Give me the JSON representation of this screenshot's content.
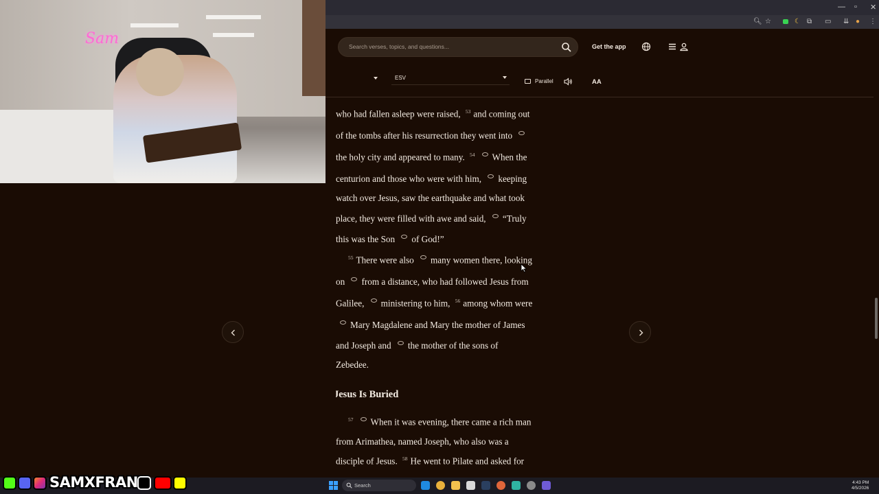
{
  "browser": {
    "window_controls": [
      "—",
      "▫",
      "✕"
    ]
  },
  "header": {
    "search_placeholder": "Search verses, topics, and questions...",
    "get_app_label": "Get the app"
  },
  "reader_toolbar": {
    "version": "ESV",
    "parallel_label": "Parallel",
    "text_size_label": "AA"
  },
  "passage": {
    "lines": [
      {
        "segments": [
          {
            "t": "who had fallen asleep were raised,"
          },
          {
            "v": "53"
          },
          {
            "t": "and coming out"
          }
        ]
      },
      {
        "segments": [
          {
            "t": "of the tombs after his resurrection they went into"
          },
          {
            "n": true
          }
        ]
      },
      {
        "segments": [
          {
            "t": "the holy city and appeared to many."
          },
          {
            "v": "54"
          },
          {
            "n": true
          },
          {
            "t": "When the"
          }
        ]
      },
      {
        "segments": [
          {
            "t": "centurion and those who were with him,"
          },
          {
            "n": true
          },
          {
            "t": "keeping"
          }
        ]
      },
      {
        "segments": [
          {
            "t": "watch over Jesus, saw the earthquake and what took"
          }
        ]
      },
      {
        "segments": [
          {
            "t": "place, they were filled with awe and said,"
          },
          {
            "n": true
          },
          {
            "t": "“Truly"
          }
        ]
      },
      {
        "segments": [
          {
            "t": "this was the Son"
          },
          {
            "n": true
          },
          {
            "t": "of God!”"
          }
        ]
      },
      {
        "segments": [
          {
            "v": "55"
          },
          {
            "t": "There were also"
          },
          {
            "n": true
          },
          {
            "t": "many women there, looking"
          }
        ],
        "indent": true
      },
      {
        "segments": [
          {
            "t": "on"
          },
          {
            "n": true
          },
          {
            "t": "from a distance, who had followed Jesus from"
          }
        ]
      },
      {
        "segments": [
          {
            "t": "Galilee,"
          },
          {
            "n": true
          },
          {
            "t": "ministering to him,"
          },
          {
            "v": "56"
          },
          {
            "t": "among whom were"
          }
        ]
      },
      {
        "segments": [
          {
            "n": true
          },
          {
            "t": "Mary Magdalene and Mary the mother of James"
          }
        ]
      },
      {
        "segments": [
          {
            "t": "and Joseph and"
          },
          {
            "n": true
          },
          {
            "t": "the mother of the sons of"
          }
        ]
      },
      {
        "segments": [
          {
            "t": "Zebedee."
          }
        ]
      }
    ],
    "heading": "Jesus Is Buried",
    "lines2": [
      {
        "segments": [
          {
            "v": "57"
          },
          {
            "n": true
          },
          {
            "t": "When it was evening, there came a rich man"
          }
        ],
        "indent": true
      },
      {
        "segments": [
          {
            "t": "from Arimathea, named Joseph, who also was a"
          }
        ]
      },
      {
        "segments": [
          {
            "t": "disciple of Jesus."
          },
          {
            "v": "58"
          },
          {
            "t": "He went to Pilate and asked for"
          }
        ]
      }
    ]
  },
  "taskbar": {
    "search_label": "Search",
    "time": "4:43 PM",
    "date": "4/5/2026"
  },
  "overlay": {
    "neon_sign": "Sam",
    "handle": "SAMXFRANK"
  },
  "colors": {
    "page_bg": "#1a0c04",
    "text": "#f3ebe2",
    "kick": "#53fc18",
    "youtube": "#ff0000",
    "snapchat": "#fffc00"
  }
}
